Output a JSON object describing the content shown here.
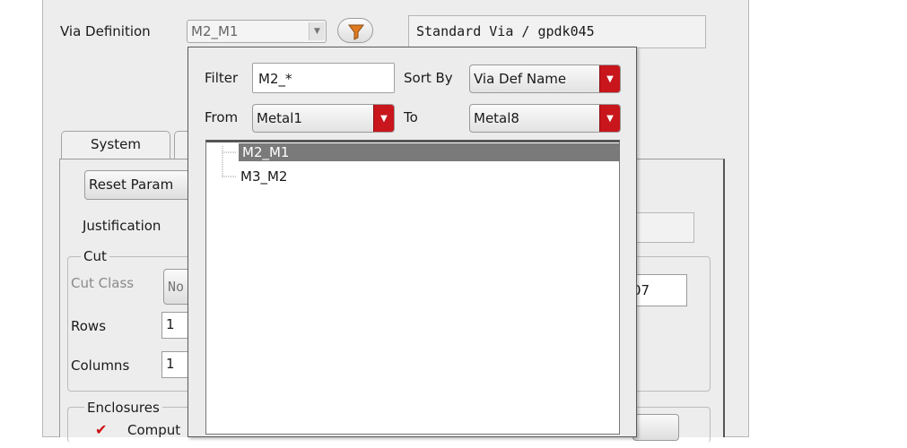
{
  "header": {
    "via_definition_label": "Via Definition",
    "via_definition_value": "M2_M1",
    "via_info": "Standard Via / gpdk045"
  },
  "tabs": [
    {
      "label": "System"
    }
  ],
  "params": {
    "reset_button_label": "Reset Param",
    "justification_label": "Justification",
    "cut_group_label": "Cut",
    "cut_class_label": "Cut Class",
    "cut_class_value": "No",
    "rows_label": "Rows",
    "rows_value": "1",
    "columns_label": "Columns",
    "columns_value": "1",
    "right_value_fragment": "07",
    "enclosures_group_label": "Enclosures",
    "compute_label": "Comput",
    "compute_checked": true
  },
  "popup": {
    "filter_label": "Filter",
    "filter_value": "M2_*",
    "sort_by_label": "Sort By",
    "sort_by_value": "Via Def Name",
    "from_label": "From",
    "from_value": "Metal1",
    "to_label": "To",
    "to_value": "Metal8",
    "tree_items": [
      {
        "label": "M2_M1",
        "selected": true
      },
      {
        "label": "M3_M2",
        "selected": false
      }
    ]
  },
  "icons": {
    "filter": "funnel-icon",
    "dropdown": "chevron-down-icon",
    "check": "checkmark-icon"
  },
  "colors": {
    "dropdown_accent": "#c9151c",
    "selection": "#7a7a7a",
    "funnel": "#e07a1f",
    "checkmark": "#cc1111"
  }
}
